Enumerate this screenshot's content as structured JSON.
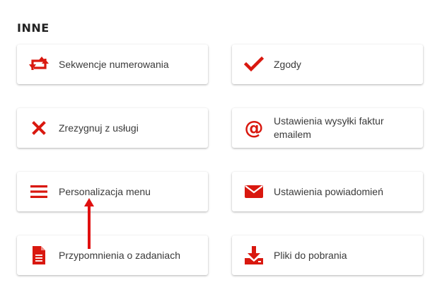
{
  "section": {
    "title": "INNE"
  },
  "tiles": [
    {
      "label": "Sekwencje numerowania",
      "icon": "sequence-arrows-icon"
    },
    {
      "label": "Zgody",
      "icon": "checkmark-icon"
    },
    {
      "label": "Zrezygnuj z usługi",
      "icon": "close-x-icon"
    },
    {
      "label": "Ustawienia wysyłki faktur emailem",
      "icon": "at-sign-icon"
    },
    {
      "label": "Personalizacja menu",
      "icon": "hamburger-menu-icon"
    },
    {
      "label": "Ustawienia powiadomień",
      "icon": "envelope-icon"
    },
    {
      "label": "Przypomnienia o zadaniach",
      "icon": "document-icon"
    },
    {
      "label": "Pliki do pobrania",
      "icon": "download-icon"
    }
  ],
  "colors": {
    "accent": "#d9180f",
    "text": "#3a3a3a",
    "heading": "#222222"
  }
}
